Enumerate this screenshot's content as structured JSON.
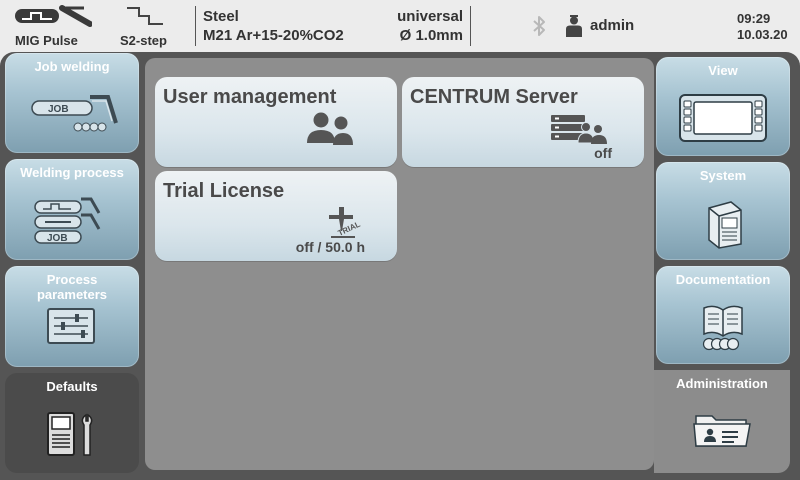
{
  "header": {
    "process_mode": "MIG Pulse",
    "operating_mode": "S2-step",
    "material": "Steel",
    "gas": "M21 Ar+15-20%CO2",
    "characteristic": "universal",
    "wire_diameter": "Ø 1.0mm",
    "user": "admin",
    "time": "09:29",
    "date": "10.03.20",
    "icons": [
      "mig-pulse-icon",
      "s2-step-icon",
      "bluetooth-icon",
      "user-icon"
    ]
  },
  "left_menu": [
    {
      "label": "Job welding",
      "icon": "job-torch-icon",
      "active": false
    },
    {
      "label": "Welding process",
      "icon": "welding-process-icon",
      "active": false
    },
    {
      "label": "Process parameters",
      "icon": "sliders-icon",
      "active": false
    },
    {
      "label": "Defaults",
      "icon": "machine-wrench-icon",
      "active": true
    }
  ],
  "right_menu": [
    {
      "label": "View",
      "icon": "display-icon",
      "active": false
    },
    {
      "label": "System",
      "icon": "power-source-icon",
      "active": false
    },
    {
      "label": "Documentation",
      "icon": "book-icon",
      "active": false
    },
    {
      "label": "Administration",
      "icon": "folder-id-icon",
      "active": true
    }
  ],
  "cards": {
    "user_management": {
      "title": "User management",
      "icon": "users-icon"
    },
    "centrum_server": {
      "title": "CENTRUM Server",
      "status": "off",
      "icon": "server-users-icon"
    },
    "trial_license": {
      "title": "Trial License",
      "status": "off / 50.0 h",
      "icon": "trial-torch-icon",
      "icon_text": "TRIAL"
    }
  },
  "colors": {
    "frame": "#555555",
    "content": "#8e8e8e",
    "tile_gradient_top": "#c8dde6",
    "tile_gradient_bottom": "#7e9fb0",
    "active_left": "#4b4b4b",
    "active_right": "#8c8c8c"
  }
}
